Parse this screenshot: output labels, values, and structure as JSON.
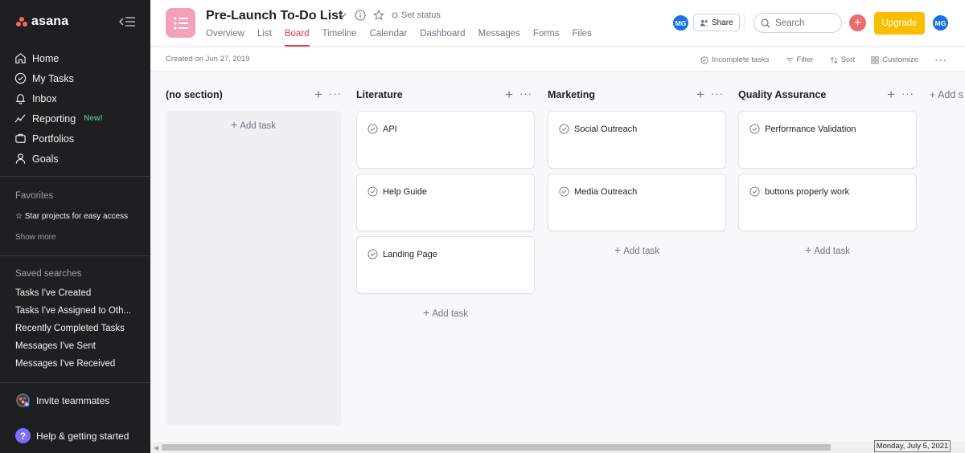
{
  "app": {
    "logo_text": "asana"
  },
  "sidebar": {
    "nav": [
      {
        "label": "Home",
        "icon": "home-icon"
      },
      {
        "label": "My Tasks",
        "icon": "check-circle-icon"
      },
      {
        "label": "Inbox",
        "icon": "bell-icon"
      },
      {
        "label": "Reporting",
        "icon": "reporting-icon",
        "badge": "New!"
      },
      {
        "label": "Portfolios",
        "icon": "folder-icon"
      },
      {
        "label": "Goals",
        "icon": "person-icon"
      }
    ],
    "favorites_title": "Favorites",
    "favorites_hint": "☆ Star projects for easy access",
    "show_more": "Show more",
    "saved_title": "Saved searches",
    "saved": [
      "Tasks I've Created",
      "Tasks I've Assigned to Oth...",
      "Recently Completed Tasks",
      "Messages I've Sent",
      "Messages I've Received"
    ],
    "invite": "Invite teammates",
    "help": "Help & getting started"
  },
  "header": {
    "title": "Pre-Launch To-Do List",
    "set_status": "Set status",
    "tabs": [
      "Overview",
      "List",
      "Board",
      "Timeline",
      "Calendar",
      "Dashboard",
      "Messages",
      "Forms",
      "Files"
    ],
    "active_tab": "Board",
    "avatar_initials": "MG",
    "share": "Share",
    "search_placeholder": "Search",
    "upgrade": "Upgrade"
  },
  "subheader": {
    "created": "Created on Jun 27, 2019",
    "incomplete": "Incomplete tasks",
    "filter": "Filter",
    "sort": "Sort",
    "customize": "Customize"
  },
  "board": {
    "add_task": "Add task",
    "add_section": "+ Add s",
    "columns": [
      {
        "title": "(no section)",
        "cards": []
      },
      {
        "title": "Literature",
        "cards": [
          "API",
          "Help Guide",
          "Landing Page"
        ]
      },
      {
        "title": "Marketing",
        "cards": [
          "Social Outreach",
          "Media Outreach"
        ]
      },
      {
        "title": "Quality Assurance",
        "cards": [
          "Performance Validation",
          "buttons properly work"
        ]
      }
    ]
  },
  "taskbar": {
    "date": "Monday, July 5, 2021"
  },
  "colors": {
    "sidebar_bg": "#1e1f21",
    "accent_tab": "#e8384f",
    "upgrade": "#fcbd01",
    "avatar": "#1873e8",
    "project_icon": "#f5a0b9"
  }
}
